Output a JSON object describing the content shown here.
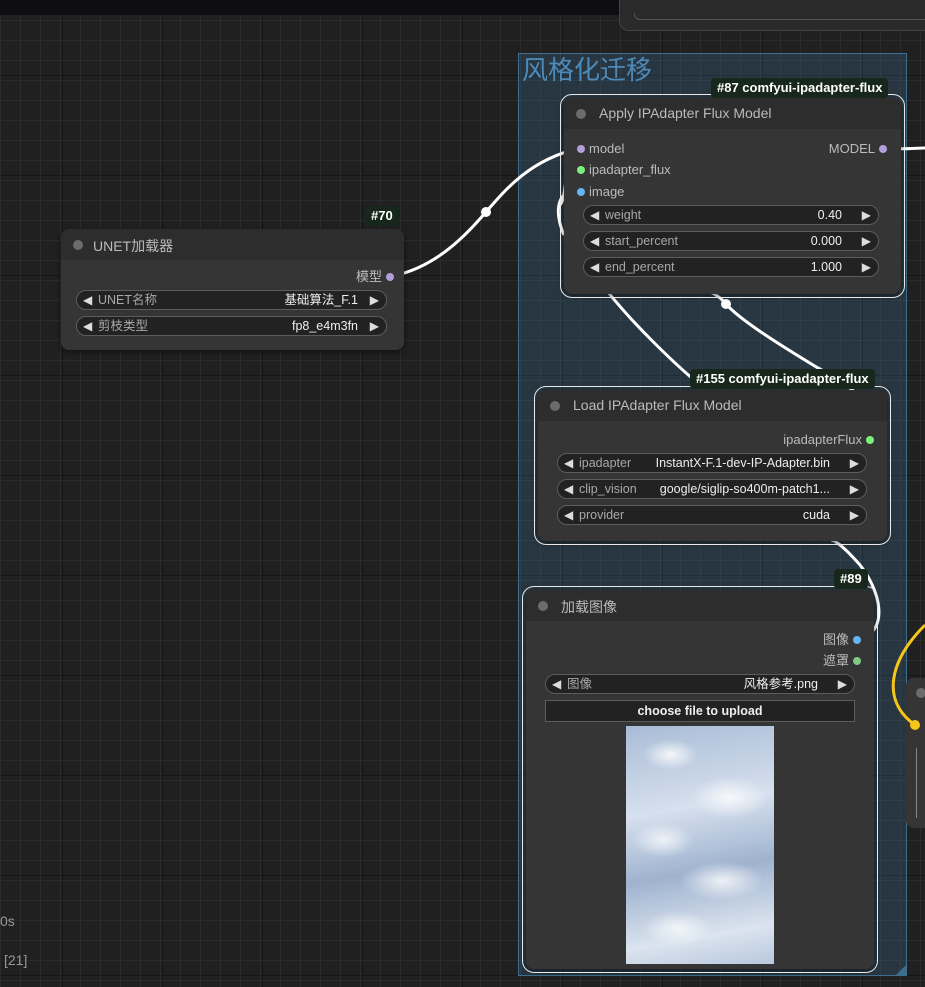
{
  "group": {
    "title": "风格化迁移"
  },
  "nodes": {
    "unet": {
      "id_badge": "#70",
      "title": "UNET加载器",
      "outputs": {
        "model": "模型"
      },
      "widgets": [
        {
          "label": "UNET名称",
          "value": "基础算法_F.1"
        },
        {
          "label": "剪枝类型",
          "value": "fp8_e4m3fn"
        }
      ]
    },
    "apply": {
      "id_badge": "#87 comfyui-ipadapter-flux",
      "title": "Apply IPAdapter Flux Model",
      "inputs": [
        "model",
        "ipadapter_flux",
        "image"
      ],
      "output": "MODEL",
      "widgets": [
        {
          "label": "weight",
          "value": "0.40"
        },
        {
          "label": "start_percent",
          "value": "0.000"
        },
        {
          "label": "end_percent",
          "value": "1.000"
        }
      ]
    },
    "load": {
      "id_badge": "#155 comfyui-ipadapter-flux",
      "title": "Load IPAdapter Flux Model",
      "output": "ipadapterFlux",
      "widgets": [
        {
          "label": "ipadapter",
          "value": "InstantX-F.1-dev-IP-Adapter.bin"
        },
        {
          "label": "clip_vision",
          "value": "google/siglip-so400m-patch1..."
        },
        {
          "label": "provider",
          "value": "cuda"
        }
      ]
    },
    "image": {
      "id_badge": "#89",
      "title": "加载图像",
      "outputs": {
        "image": "图像",
        "mask": "遮罩"
      },
      "widgets": [
        {
          "label": "图像",
          "value": "风格参考.png"
        }
      ],
      "upload_button": "choose file to upload"
    }
  },
  "status": {
    "time": "0s",
    "queue": "[21]"
  },
  "colors": {
    "model_socket": "#b39ddb",
    "ipadapter_socket": "#7cf07c",
    "image_socket": "#64b5f6",
    "mask_socket": "#81c784",
    "yellow_link": "#f5c518",
    "link": "#ffffff",
    "group_fill": "#3a6e96",
    "badge_bg": "#17271c"
  }
}
